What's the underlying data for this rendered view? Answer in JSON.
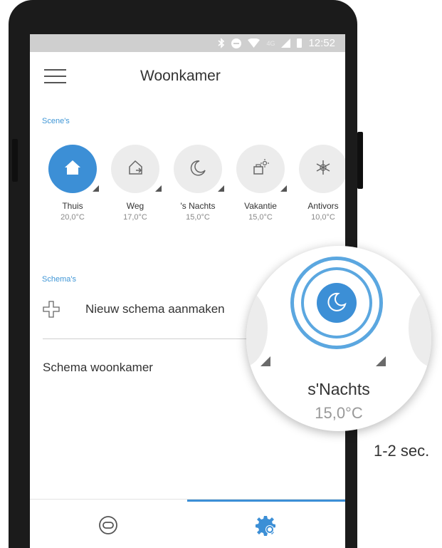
{
  "status_bar": {
    "time": "12:52",
    "network": "4G"
  },
  "header": {
    "title": "Woonkamer"
  },
  "scenes": {
    "label": "Scene's",
    "items": [
      {
        "name": "Thuis",
        "temp": "20,0°C",
        "icon": "home-icon",
        "active": true
      },
      {
        "name": "Weg",
        "temp": "17,0°C",
        "icon": "leave-home-icon",
        "active": false
      },
      {
        "name": "'s Nachts",
        "temp": "15,0°C",
        "icon": "moon-icon",
        "active": false
      },
      {
        "name": "Vakantie",
        "temp": "15,0°C",
        "icon": "suitcase-sun-icon",
        "active": false
      },
      {
        "name": "Antivors",
        "temp": "10,0°C",
        "icon": "snowflake-icon",
        "active": false
      }
    ]
  },
  "schemas": {
    "label": "Schema's",
    "new_schema_label": "Nieuw schema aanmaken",
    "items": [
      "Schema woonkamer"
    ]
  },
  "magnifier": {
    "scene_name": "s'Nachts",
    "scene_temp": "15,0°C",
    "icon": "moon-icon"
  },
  "caption": {
    "duration": "1-2 sec."
  },
  "colors": {
    "accent": "#3c8fd6",
    "status_bar": "#cfcfcf"
  }
}
